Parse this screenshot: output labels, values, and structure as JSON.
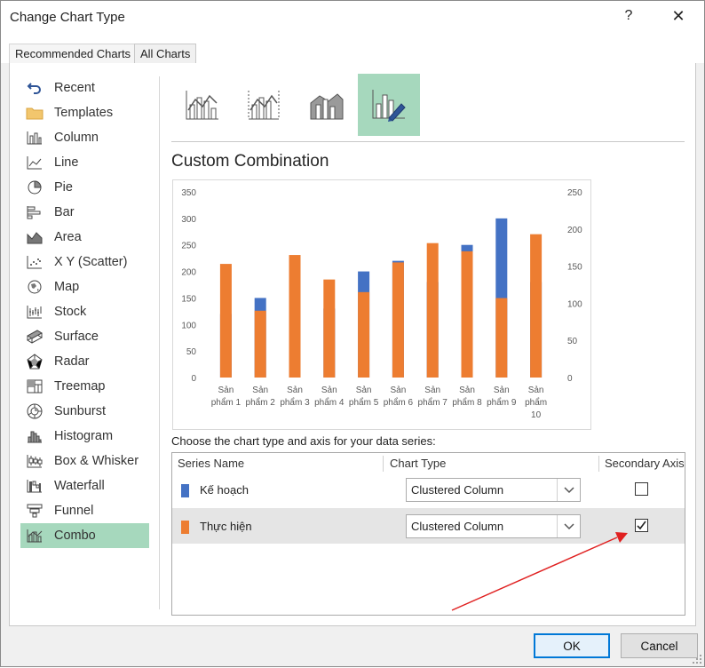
{
  "dialog": {
    "title": "Change Chart Type",
    "help_label": "?",
    "close_label": "✕"
  },
  "tabs": [
    {
      "label": "Recommended Charts",
      "active": false
    },
    {
      "label": "All Charts",
      "active": true
    }
  ],
  "sidebar": {
    "items": [
      {
        "label": "Recent",
        "icon": "recent-icon"
      },
      {
        "label": "Templates",
        "icon": "folder-icon"
      },
      {
        "label": "Column",
        "icon": "column-chart-icon"
      },
      {
        "label": "Line",
        "icon": "line-chart-icon"
      },
      {
        "label": "Pie",
        "icon": "pie-chart-icon"
      },
      {
        "label": "Bar",
        "icon": "bar-chart-icon"
      },
      {
        "label": "Area",
        "icon": "area-chart-icon"
      },
      {
        "label": "X Y (Scatter)",
        "icon": "scatter-chart-icon"
      },
      {
        "label": "Map",
        "icon": "map-chart-icon"
      },
      {
        "label": "Stock",
        "icon": "stock-chart-icon"
      },
      {
        "label": "Surface",
        "icon": "surface-chart-icon"
      },
      {
        "label": "Radar",
        "icon": "radar-chart-icon"
      },
      {
        "label": "Treemap",
        "icon": "treemap-chart-icon"
      },
      {
        "label": "Sunburst",
        "icon": "sunburst-chart-icon"
      },
      {
        "label": "Histogram",
        "icon": "histogram-chart-icon"
      },
      {
        "label": "Box & Whisker",
        "icon": "box-whisker-chart-icon"
      },
      {
        "label": "Waterfall",
        "icon": "waterfall-chart-icon"
      },
      {
        "label": "Funnel",
        "icon": "funnel-chart-icon"
      },
      {
        "label": "Combo",
        "icon": "combo-chart-icon",
        "active": true
      }
    ]
  },
  "combo_subtypes": [
    {
      "icon": "clustered-column-line-icon"
    },
    {
      "icon": "clustered-column-line-secondary-icon"
    },
    {
      "icon": "stacked-area-clustered-column-icon"
    },
    {
      "icon": "custom-combination-icon",
      "active": true
    }
  ],
  "section_title": "Custom Combination",
  "chart_data": {
    "type": "bar",
    "categories": [
      "Sản phẩm 1",
      "Sản phẩm 2",
      "Sản phẩm 3",
      "Sản phẩm 4",
      "Sản phẩm 5",
      "Sản phẩm 6",
      "Sản phẩm 7",
      "Sản phẩm 8",
      "Sản phẩm 9",
      "Sản phẩm 10"
    ],
    "category_lines": [
      [
        "Sản",
        "phẩm 1"
      ],
      [
        "Sản",
        "phẩm 2"
      ],
      [
        "Sản",
        "phẩm 3"
      ],
      [
        "Sản",
        "phẩm 4"
      ],
      [
        "Sản",
        "phẩm 5"
      ],
      [
        "Sản",
        "phẩm 6"
      ],
      [
        "Sản",
        "phẩm 7"
      ],
      [
        "Sản",
        "phẩm 8"
      ],
      [
        "Sản",
        "phẩm 9"
      ],
      [
        "Sản",
        "phẩm",
        "10"
      ]
    ],
    "series": [
      {
        "name": "Kế hoạch",
        "axis": "primary",
        "color": "#4472c4",
        "values": [
          120,
          150,
          130,
          130,
          200,
          220,
          180,
          250,
          300,
          180
        ]
      },
      {
        "name": "Thực hiện",
        "axis": "secondary",
        "color": "#ed7d31",
        "values": [
          153,
          90,
          165,
          132,
          115,
          155,
          181,
          170,
          107,
          193
        ]
      }
    ],
    "ylim": [
      0,
      350
    ],
    "yticks": [
      0,
      50,
      100,
      150,
      200,
      250,
      300,
      350
    ],
    "y2lim": [
      0,
      250
    ],
    "y2ticks": [
      0,
      50,
      100,
      150,
      200,
      250
    ],
    "grid": false,
    "title": "",
    "xlabel": "",
    "ylabel": ""
  },
  "series_prompt": "Choose the chart type and axis for your data series:",
  "series_table": {
    "headers": {
      "name": "Series Name",
      "type": "Chart Type",
      "secondary": "Secondary Axis"
    },
    "rows": [
      {
        "name": "Kế hoạch",
        "color": "#4472c4",
        "chart_type": "Clustered Column",
        "secondary": false,
        "selected": false
      },
      {
        "name": "Thực hiện",
        "color": "#ed7d31",
        "chart_type": "Clustered Column",
        "secondary": true,
        "selected": true
      }
    ]
  },
  "buttons": {
    "ok": "OK",
    "cancel": "Cancel"
  },
  "annotation": {
    "color": "#e02020"
  }
}
